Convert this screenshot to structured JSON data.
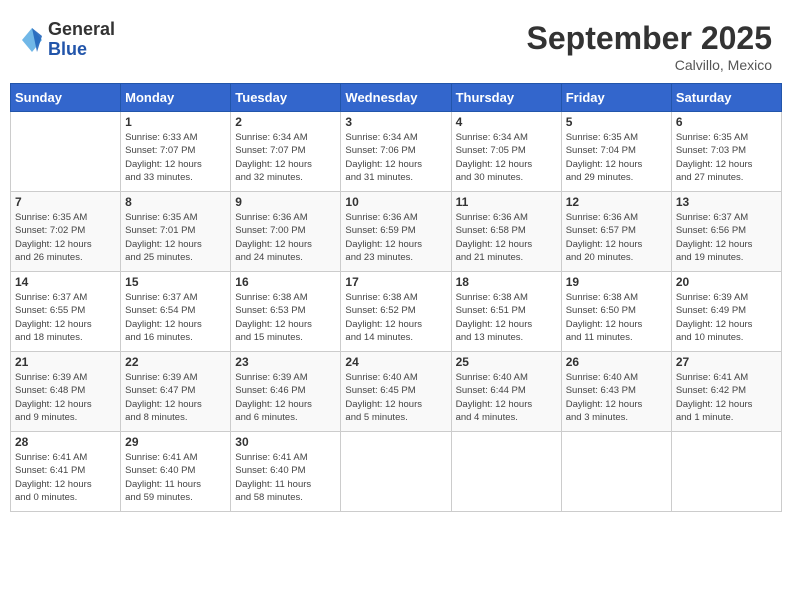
{
  "header": {
    "logo": {
      "general": "General",
      "blue": "Blue"
    },
    "title": "September 2025",
    "location": "Calvillo, Mexico"
  },
  "weekdays": [
    "Sunday",
    "Monday",
    "Tuesday",
    "Wednesday",
    "Thursday",
    "Friday",
    "Saturday"
  ],
  "weeks": [
    [
      {
        "day": "",
        "info": ""
      },
      {
        "day": "1",
        "info": "Sunrise: 6:33 AM\nSunset: 7:07 PM\nDaylight: 12 hours\nand 33 minutes."
      },
      {
        "day": "2",
        "info": "Sunrise: 6:34 AM\nSunset: 7:07 PM\nDaylight: 12 hours\nand 32 minutes."
      },
      {
        "day": "3",
        "info": "Sunrise: 6:34 AM\nSunset: 7:06 PM\nDaylight: 12 hours\nand 31 minutes."
      },
      {
        "day": "4",
        "info": "Sunrise: 6:34 AM\nSunset: 7:05 PM\nDaylight: 12 hours\nand 30 minutes."
      },
      {
        "day": "5",
        "info": "Sunrise: 6:35 AM\nSunset: 7:04 PM\nDaylight: 12 hours\nand 29 minutes."
      },
      {
        "day": "6",
        "info": "Sunrise: 6:35 AM\nSunset: 7:03 PM\nDaylight: 12 hours\nand 27 minutes."
      }
    ],
    [
      {
        "day": "7",
        "info": "Sunrise: 6:35 AM\nSunset: 7:02 PM\nDaylight: 12 hours\nand 26 minutes."
      },
      {
        "day": "8",
        "info": "Sunrise: 6:35 AM\nSunset: 7:01 PM\nDaylight: 12 hours\nand 25 minutes."
      },
      {
        "day": "9",
        "info": "Sunrise: 6:36 AM\nSunset: 7:00 PM\nDaylight: 12 hours\nand 24 minutes."
      },
      {
        "day": "10",
        "info": "Sunrise: 6:36 AM\nSunset: 6:59 PM\nDaylight: 12 hours\nand 23 minutes."
      },
      {
        "day": "11",
        "info": "Sunrise: 6:36 AM\nSunset: 6:58 PM\nDaylight: 12 hours\nand 21 minutes."
      },
      {
        "day": "12",
        "info": "Sunrise: 6:36 AM\nSunset: 6:57 PM\nDaylight: 12 hours\nand 20 minutes."
      },
      {
        "day": "13",
        "info": "Sunrise: 6:37 AM\nSunset: 6:56 PM\nDaylight: 12 hours\nand 19 minutes."
      }
    ],
    [
      {
        "day": "14",
        "info": "Sunrise: 6:37 AM\nSunset: 6:55 PM\nDaylight: 12 hours\nand 18 minutes."
      },
      {
        "day": "15",
        "info": "Sunrise: 6:37 AM\nSunset: 6:54 PM\nDaylight: 12 hours\nand 16 minutes."
      },
      {
        "day": "16",
        "info": "Sunrise: 6:38 AM\nSunset: 6:53 PM\nDaylight: 12 hours\nand 15 minutes."
      },
      {
        "day": "17",
        "info": "Sunrise: 6:38 AM\nSunset: 6:52 PM\nDaylight: 12 hours\nand 14 minutes."
      },
      {
        "day": "18",
        "info": "Sunrise: 6:38 AM\nSunset: 6:51 PM\nDaylight: 12 hours\nand 13 minutes."
      },
      {
        "day": "19",
        "info": "Sunrise: 6:38 AM\nSunset: 6:50 PM\nDaylight: 12 hours\nand 11 minutes."
      },
      {
        "day": "20",
        "info": "Sunrise: 6:39 AM\nSunset: 6:49 PM\nDaylight: 12 hours\nand 10 minutes."
      }
    ],
    [
      {
        "day": "21",
        "info": "Sunrise: 6:39 AM\nSunset: 6:48 PM\nDaylight: 12 hours\nand 9 minutes."
      },
      {
        "day": "22",
        "info": "Sunrise: 6:39 AM\nSunset: 6:47 PM\nDaylight: 12 hours\nand 8 minutes."
      },
      {
        "day": "23",
        "info": "Sunrise: 6:39 AM\nSunset: 6:46 PM\nDaylight: 12 hours\nand 6 minutes."
      },
      {
        "day": "24",
        "info": "Sunrise: 6:40 AM\nSunset: 6:45 PM\nDaylight: 12 hours\nand 5 minutes."
      },
      {
        "day": "25",
        "info": "Sunrise: 6:40 AM\nSunset: 6:44 PM\nDaylight: 12 hours\nand 4 minutes."
      },
      {
        "day": "26",
        "info": "Sunrise: 6:40 AM\nSunset: 6:43 PM\nDaylight: 12 hours\nand 3 minutes."
      },
      {
        "day": "27",
        "info": "Sunrise: 6:41 AM\nSunset: 6:42 PM\nDaylight: 12 hours\nand 1 minute."
      }
    ],
    [
      {
        "day": "28",
        "info": "Sunrise: 6:41 AM\nSunset: 6:41 PM\nDaylight: 12 hours\nand 0 minutes."
      },
      {
        "day": "29",
        "info": "Sunrise: 6:41 AM\nSunset: 6:40 PM\nDaylight: 11 hours\nand 59 minutes."
      },
      {
        "day": "30",
        "info": "Sunrise: 6:41 AM\nSunset: 6:40 PM\nDaylight: 11 hours\nand 58 minutes."
      },
      {
        "day": "",
        "info": ""
      },
      {
        "day": "",
        "info": ""
      },
      {
        "day": "",
        "info": ""
      },
      {
        "day": "",
        "info": ""
      }
    ]
  ]
}
